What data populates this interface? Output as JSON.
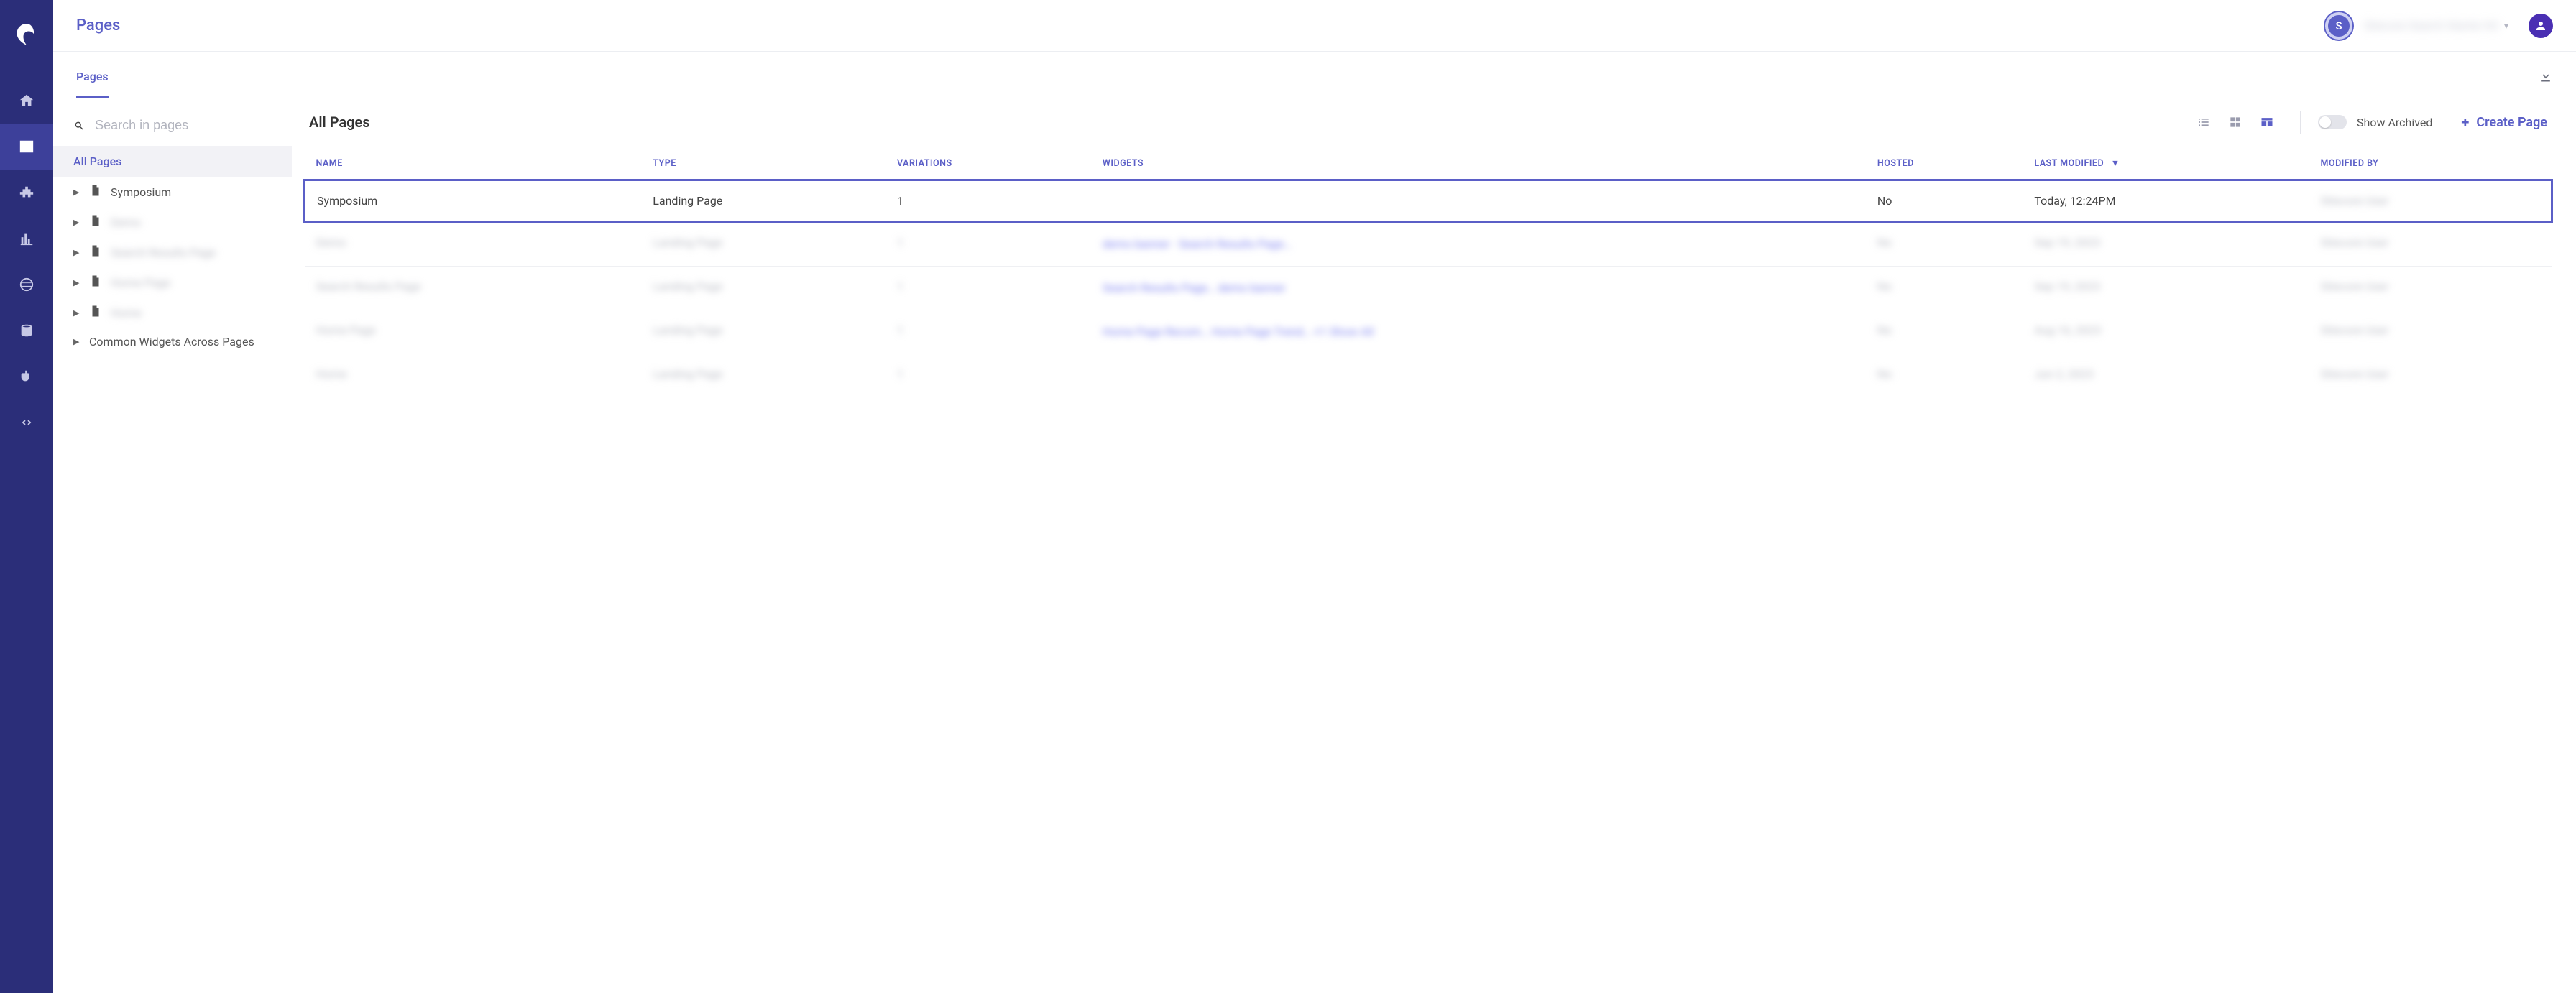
{
  "header": {
    "title": "Pages",
    "tenant_badge": "S",
    "tenant_name": "Sitecore Search Starter Kit",
    "tenant_caret": "▾"
  },
  "tabs": {
    "active": "Pages"
  },
  "sidebar": {
    "search_placeholder": "Search in pages",
    "root": "All Pages",
    "items": [
      {
        "label": "Symposium",
        "blurred": false
      },
      {
        "label": "Demo",
        "blurred": true
      },
      {
        "label": "Search Results Page",
        "blurred": true
      },
      {
        "label": "Home Page",
        "blurred": true
      },
      {
        "label": "Home",
        "blurred": true
      }
    ],
    "common": "Common Widgets Across Pages"
  },
  "toolbar": {
    "heading": "All Pages",
    "archived_label": "Show Archived",
    "create_label": "Create Page"
  },
  "table": {
    "headers": {
      "name": "NAME",
      "type": "TYPE",
      "variations": "VARIATIONS",
      "widgets": "WIDGETS",
      "hosted": "HOSTED",
      "last_modified": "LAST MODIFIED",
      "modified_by": "MODIFIED BY"
    },
    "rows": [
      {
        "name": "Symposium",
        "type": "Landing Page",
        "variations": "1",
        "widgets": "",
        "hosted": "No",
        "last_modified": "Today, 12:24PM",
        "modified_by": "Sitecore User",
        "highlight": true,
        "blurred": false
      },
      {
        "name": "Demo",
        "type": "Landing Page",
        "variations": "1",
        "widgets": "demo banner · Search Results Page…",
        "hosted": "No",
        "last_modified": "Sep 19, 2023",
        "modified_by": "Sitecore User",
        "blurred": true
      },
      {
        "name": "Search Results Page",
        "type": "Landing Page",
        "variations": "1",
        "widgets": "Search Results Page… demo banner",
        "hosted": "No",
        "last_modified": "Sep 19, 2023",
        "modified_by": "Sitecore User",
        "blurred": true
      },
      {
        "name": "Home Page",
        "type": "Landing Page",
        "variations": "1",
        "widgets": "Home Page Recom… Home Page Trend… +1  Show All",
        "hosted": "No",
        "last_modified": "Aug 16, 2023",
        "modified_by": "Sitecore User",
        "blurred": true
      },
      {
        "name": "Home",
        "type": "Landing Page",
        "variations": "1",
        "widgets": "",
        "hosted": "No",
        "last_modified": "Jun 2, 2023",
        "modified_by": "Sitecore User",
        "blurred": true
      }
    ]
  }
}
